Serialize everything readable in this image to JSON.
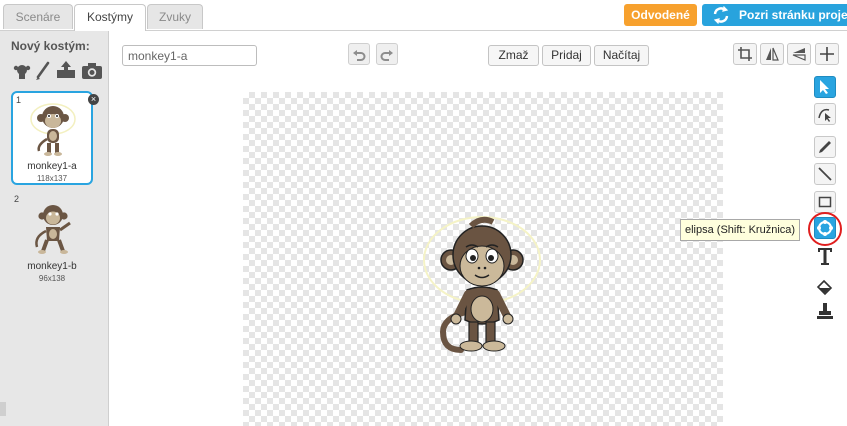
{
  "tabs": [
    {
      "label": "Scenáre",
      "active": false
    },
    {
      "label": "Kostýmy",
      "active": true
    },
    {
      "label": "Zvuky",
      "active": false
    }
  ],
  "header_buttons": {
    "remix_label": "Odvodené",
    "project_page_label": "Pozri stránku proje"
  },
  "new_costume": {
    "label": "Nový kostým:",
    "tools": [
      "paint-from-library-icon",
      "paint-brush-icon",
      "upload-icon",
      "camera-icon"
    ]
  },
  "costumes": [
    {
      "number": "1",
      "name": "monkey1-a",
      "size": "118x137",
      "selected": true
    },
    {
      "number": "2",
      "name": "monkey1-b",
      "size": "96x138",
      "selected": false
    }
  ],
  "editor": {
    "costume_name_value": "monkey1-a",
    "clear_label": "Zmaž",
    "add_label": "Pridaj",
    "import_label": "Načítaj"
  },
  "tooltip": {
    "text": "elipsa (Shift: Kružnica)"
  },
  "colors": {
    "accent_blue": "#29a4e0",
    "remix_orange": "#f7a12e",
    "highlight_red": "#e01e1e"
  }
}
